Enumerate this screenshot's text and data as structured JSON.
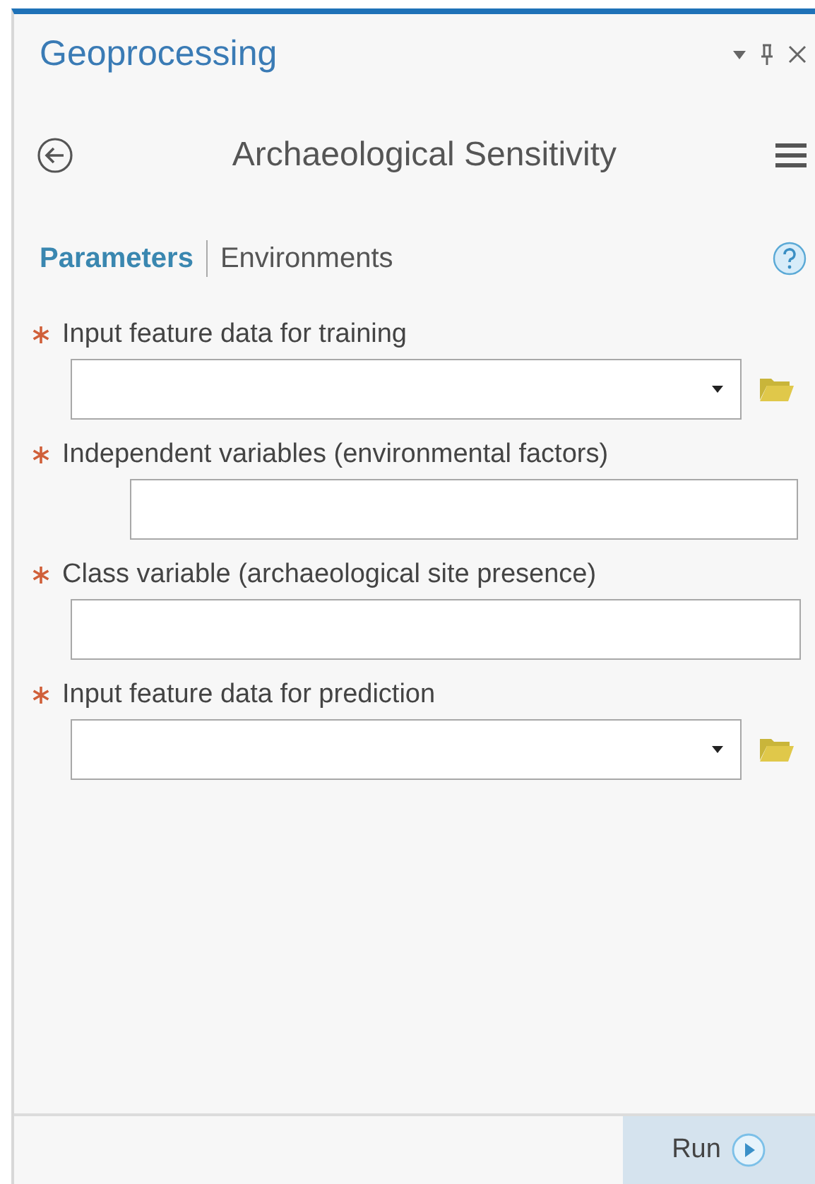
{
  "pane": {
    "title": "Geoprocessing"
  },
  "tool": {
    "title": "Archaeological Sensitivity"
  },
  "tabs": [
    {
      "label": "Parameters",
      "selected": true
    },
    {
      "label": "Environments",
      "selected": false
    }
  ],
  "parameters": [
    {
      "label": "Input feature data for training",
      "required": true,
      "kind": "dropdown"
    },
    {
      "label": "Independent variables (environmental factors)",
      "required": true,
      "kind": "list"
    },
    {
      "label": "Class variable (archaeological site presence)",
      "required": true,
      "kind": "text"
    },
    {
      "label": "Input feature data for prediction",
      "required": true,
      "kind": "dropdown"
    }
  ],
  "run_button": {
    "label": "Run"
  }
}
